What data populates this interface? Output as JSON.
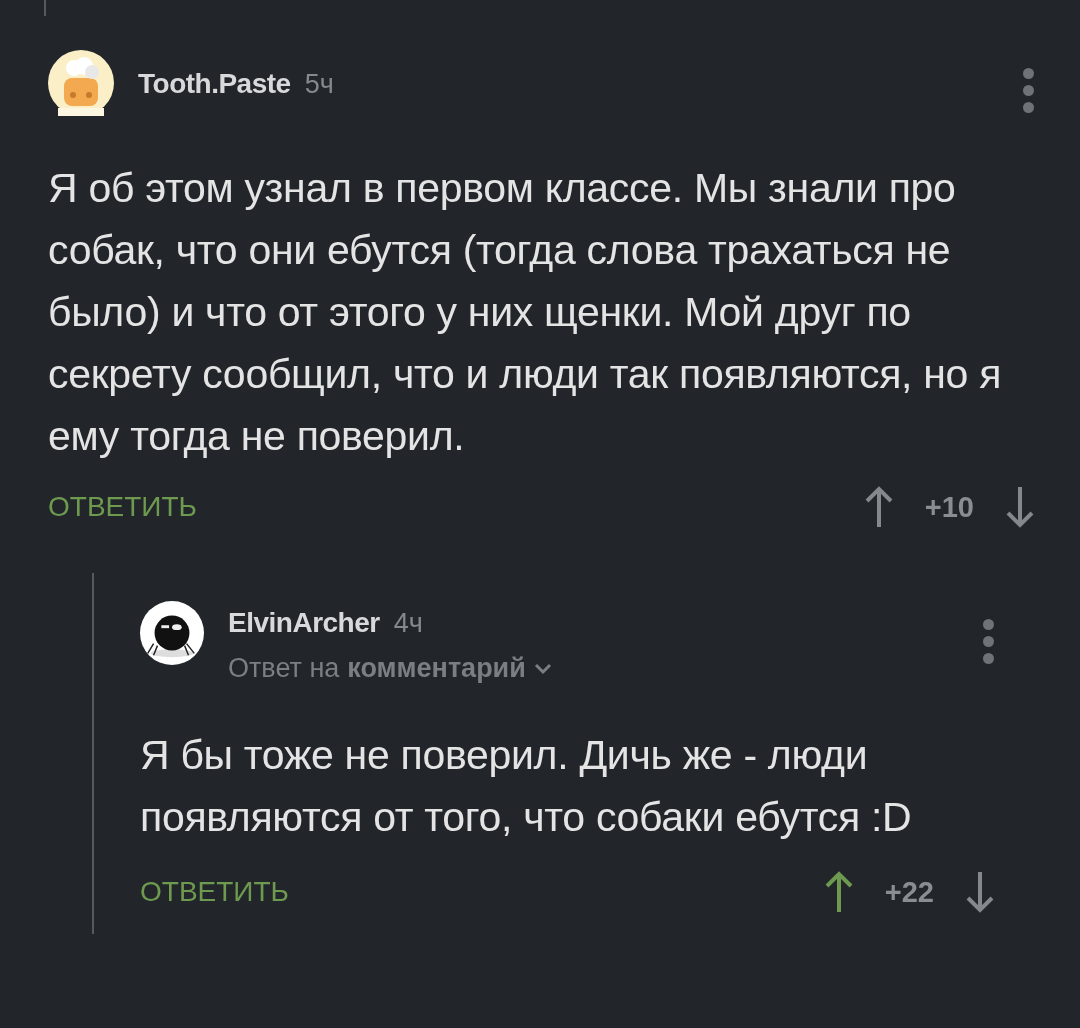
{
  "comments": [
    {
      "author": "Tooth.Paste",
      "time": "5ч",
      "text": "Я об этом узнал в первом классе. Мы знали про собак, что они ебутся (тогда слова трахаться не было) и что от этого у них щенки. Мой друг по секрету сообщил, что и люди так появляются, но я ему тогда не поверил.",
      "reply_label": "ОТВЕТИТЬ",
      "rating": "+10",
      "upvoted": false,
      "downvoted": false,
      "children": [
        {
          "author": "ElvinArcher",
          "time": "4ч",
          "reply_to": {
            "prefix": "Ответ на",
            "link": "комментарий"
          },
          "text": "Я бы тоже не поверил. Дичь же - люди появляются от того, что собаки ебутся :D",
          "reply_label": "ОТВЕТИТЬ",
          "rating": "+22",
          "upvoted": true,
          "downvoted": false
        }
      ]
    }
  ]
}
